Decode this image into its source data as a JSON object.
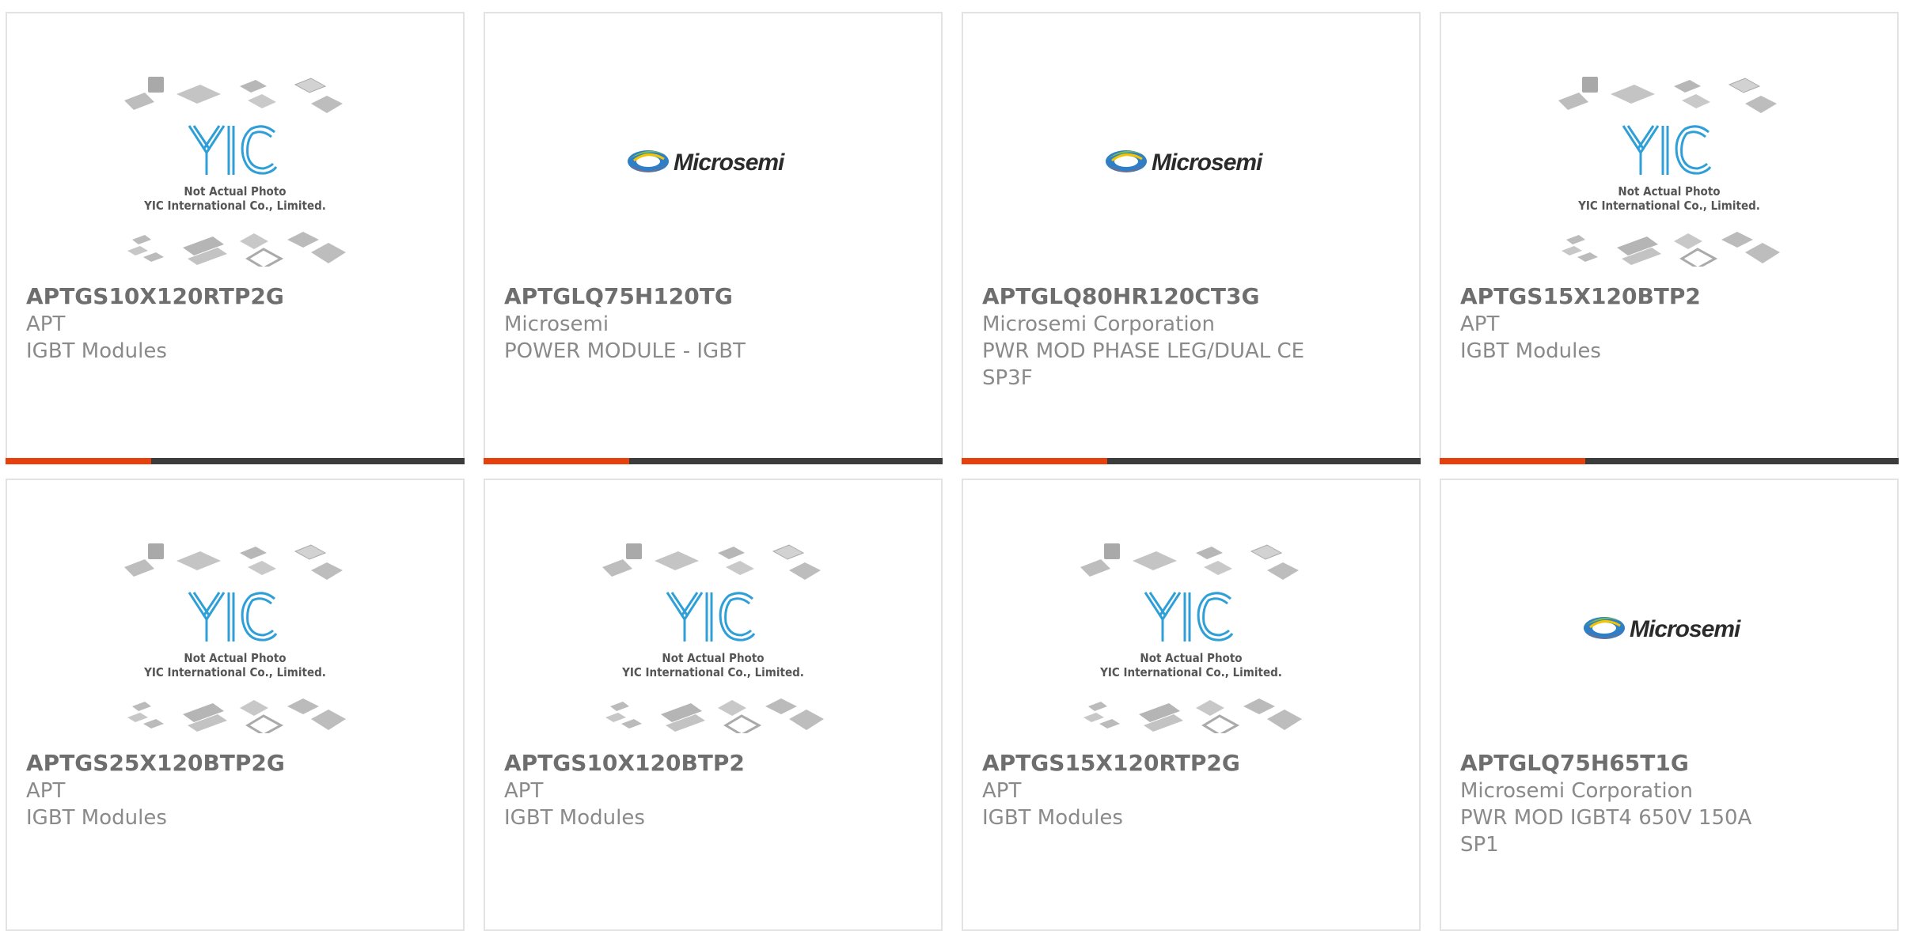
{
  "products": [
    {
      "part": "APTGS10X120RTP2G",
      "maker": "APT",
      "desc": "IGBT Modules",
      "image": "yic-placeholder",
      "bar": true
    },
    {
      "part": "APTGLQ75H120TG",
      "maker": "Microsemi",
      "desc": "POWER MODULE - IGBT",
      "image": "microsemi-logo",
      "bar": true
    },
    {
      "part": "APTGLQ80HR120CT3G",
      "maker": "Microsemi Corporation",
      "desc": "PWR MOD PHASE LEG/DUAL CE SP3F",
      "image": "microsemi-logo",
      "bar": true
    },
    {
      "part": "APTGS15X120BTP2",
      "maker": "APT",
      "desc": "IGBT Modules",
      "image": "yic-placeholder",
      "bar": true
    },
    {
      "part": "APTGS25X120BTP2G",
      "maker": "APT",
      "desc": "IGBT Modules",
      "image": "yic-placeholder",
      "bar": false
    },
    {
      "part": "APTGS10X120BTP2",
      "maker": "APT",
      "desc": "IGBT Modules",
      "image": "yic-placeholder",
      "bar": false
    },
    {
      "part": "APTGS15X120RTP2G",
      "maker": "APT",
      "desc": "IGBT Modules",
      "image": "yic-placeholder",
      "bar": false
    },
    {
      "part": "APTGLQ75H65T1G",
      "maker": "Microsemi Corporation",
      "desc": "PWR MOD IGBT4 650V 150A SP1",
      "image": "microsemi-logo",
      "bar": false
    }
  ],
  "placeholder": {
    "line1": "Not Actual Photo",
    "line2": "YIC International Co., Limited."
  },
  "logo_text": "Microsemi",
  "colors": {
    "accent": "#e8400c",
    "bar": "#3c3c3c",
    "yic_blue": "#2f9fd8"
  }
}
